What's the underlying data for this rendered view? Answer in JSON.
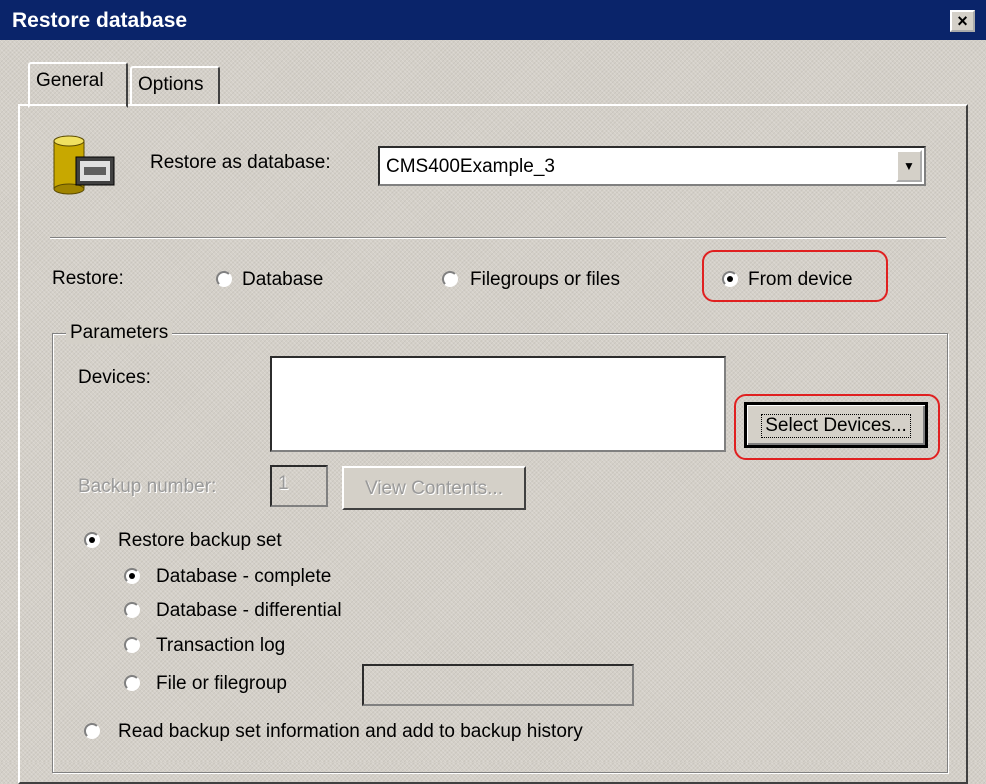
{
  "window": {
    "title": "Restore database",
    "close_glyph": "×"
  },
  "tabs": [
    {
      "label": "General",
      "active": true
    },
    {
      "label": "Options",
      "active": false
    }
  ],
  "restore_as": {
    "label": "Restore as database:",
    "value": "CMS400Example_3"
  },
  "restore": {
    "label": "Restore:",
    "options": [
      {
        "label": "Database",
        "selected": false
      },
      {
        "label": "Filegroups or files",
        "selected": false
      },
      {
        "label": "From device",
        "selected": true
      }
    ]
  },
  "parameters": {
    "legend": "Parameters",
    "devices_label": "Devices:",
    "select_devices_button": "Select Devices...",
    "backup_number_label": "Backup number:",
    "backup_number_value": "1",
    "view_contents_button": "View Contents...",
    "restore_backup_set": {
      "label": "Restore backup set",
      "selected": true
    },
    "backup_types": [
      {
        "label": "Database - complete",
        "selected": true
      },
      {
        "label": "Database - differential",
        "selected": false
      },
      {
        "label": "Transaction log",
        "selected": false
      },
      {
        "label": "File or filegroup",
        "selected": false
      }
    ],
    "read_backup_info": {
      "label": "Read backup set information and add to backup history",
      "selected": false
    }
  },
  "colors": {
    "titlebar": "#0a246a",
    "face": "#d4d0c8",
    "highlight": "#e02020"
  },
  "icons": [
    "database-icon",
    "close-icon",
    "dropdown-arrow-icon"
  ]
}
